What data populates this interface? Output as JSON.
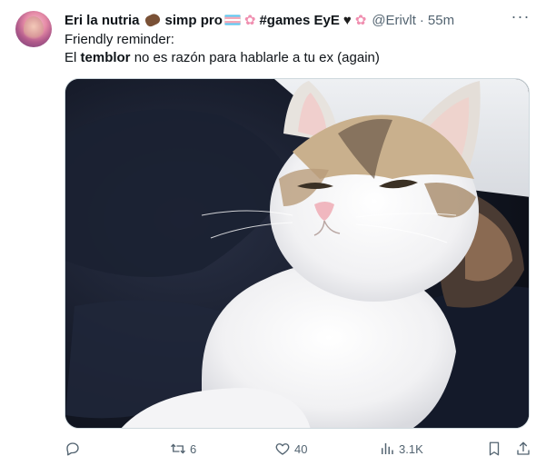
{
  "author": {
    "name": "Eri la nutria",
    "name_suffix": "simp pro",
    "hashtag": "#games EyE",
    "handle": "@Erivlt",
    "separator": "·",
    "time": "55m"
  },
  "tweet": {
    "line1": "Friendly reminder:",
    "line2_pre": "El ",
    "line2_bold": "temblor",
    "line2_post": " no es razón para hablarle a tu ex (again)"
  },
  "media": {
    "subject": "cat-photo"
  },
  "actions": {
    "reply_count": "",
    "retweet_count": "6",
    "like_count": "40",
    "views_count": "3.1K"
  },
  "icons": [
    "more-icon",
    "reply-icon",
    "retweet-icon",
    "like-icon",
    "views-icon",
    "bookmark-icon",
    "share-icon"
  ],
  "colors": {
    "text": "#0f1419",
    "secondary": "#536471",
    "border": "#cfd9de"
  }
}
